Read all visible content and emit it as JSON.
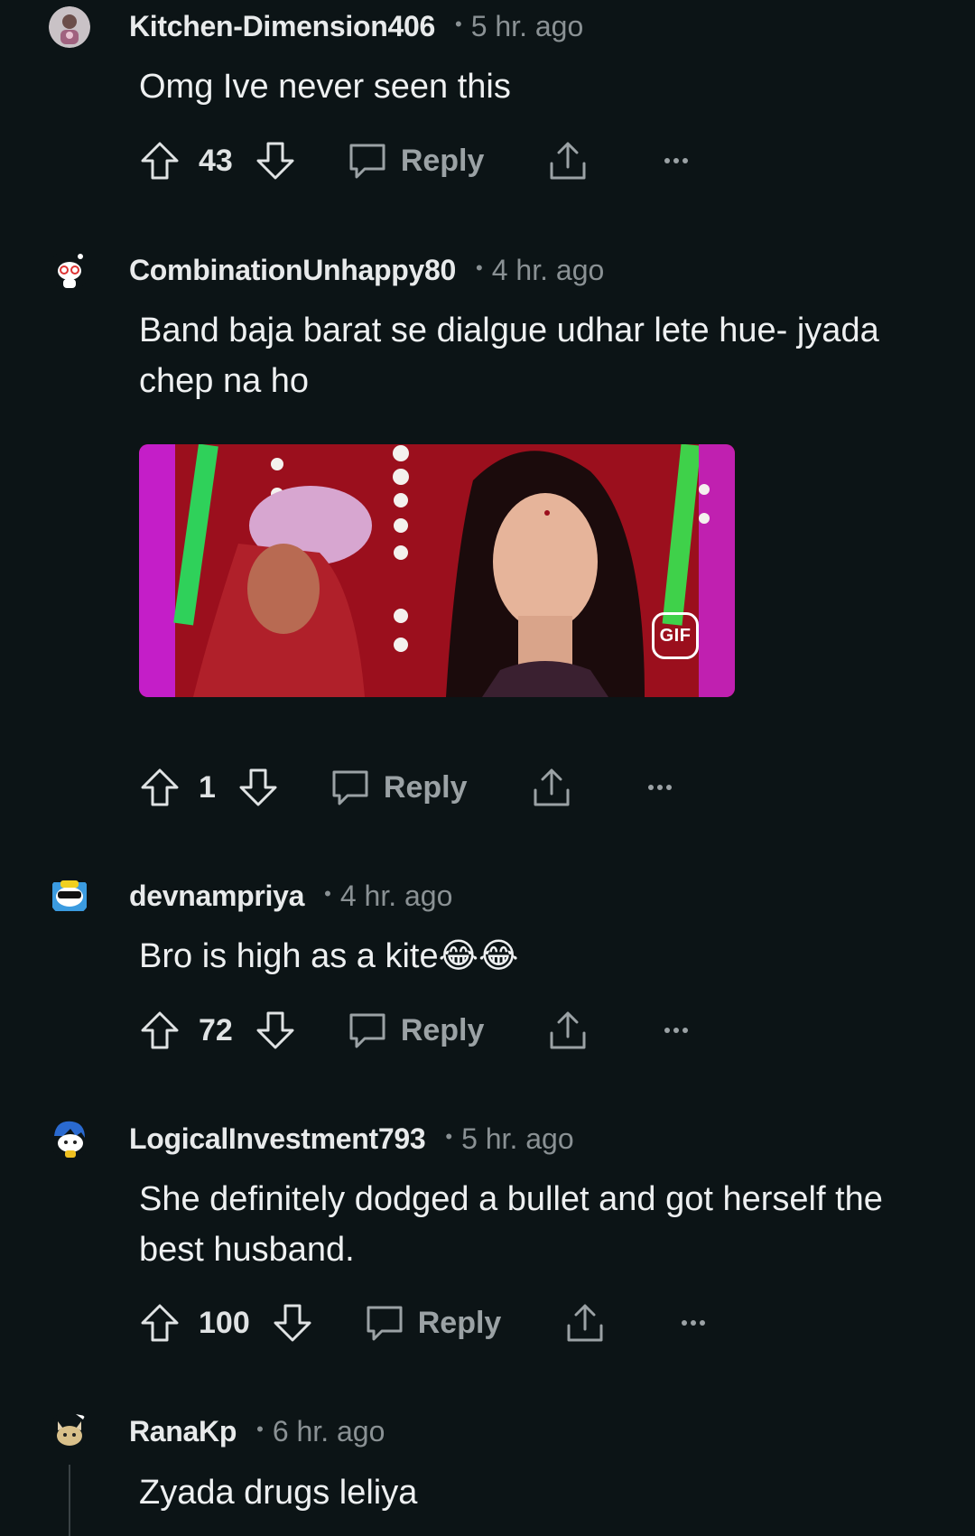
{
  "comments": [
    {
      "author": "Kitchen-Dimension406",
      "separator": "•",
      "time": "5 hr. ago",
      "text": "Omg Ive never seen this",
      "score": "43",
      "reply_label": "Reply",
      "avatar_icon": "user-photo-avatar"
    },
    {
      "author": "CombinationUnhappy80",
      "separator": "•",
      "time": "4 hr. ago",
      "text": "Band baja barat se dialgue udhar lete hue- jyada chep na ho",
      "gif_badge": "GIF",
      "score": "1",
      "reply_label": "Reply",
      "avatar_icon": "snoo-glasses-avatar"
    },
    {
      "author": "devnampriya",
      "separator": "•",
      "time": "4 hr. ago",
      "text": "Bro is high as a kite😂😂",
      "score": "72",
      "reply_label": "Reply",
      "avatar_icon": "snoo-sunglasses-avatar"
    },
    {
      "author": "LogicalInvestment793",
      "separator": "•",
      "time": "5 hr. ago",
      "text": "She definitely dodged a bullet and got herself the best husband.",
      "score": "100",
      "reply_label": "Reply",
      "avatar_icon": "snoo-blue-hair-avatar"
    },
    {
      "author": "RanaKp",
      "separator": "•",
      "time": "6 hr. ago",
      "text": "Zyada drugs leliya",
      "avatar_icon": "snoo-cat-avatar"
    }
  ],
  "colors": {
    "background": "#0c1416",
    "text": "#eef0f1",
    "muted": "#8a9194"
  }
}
